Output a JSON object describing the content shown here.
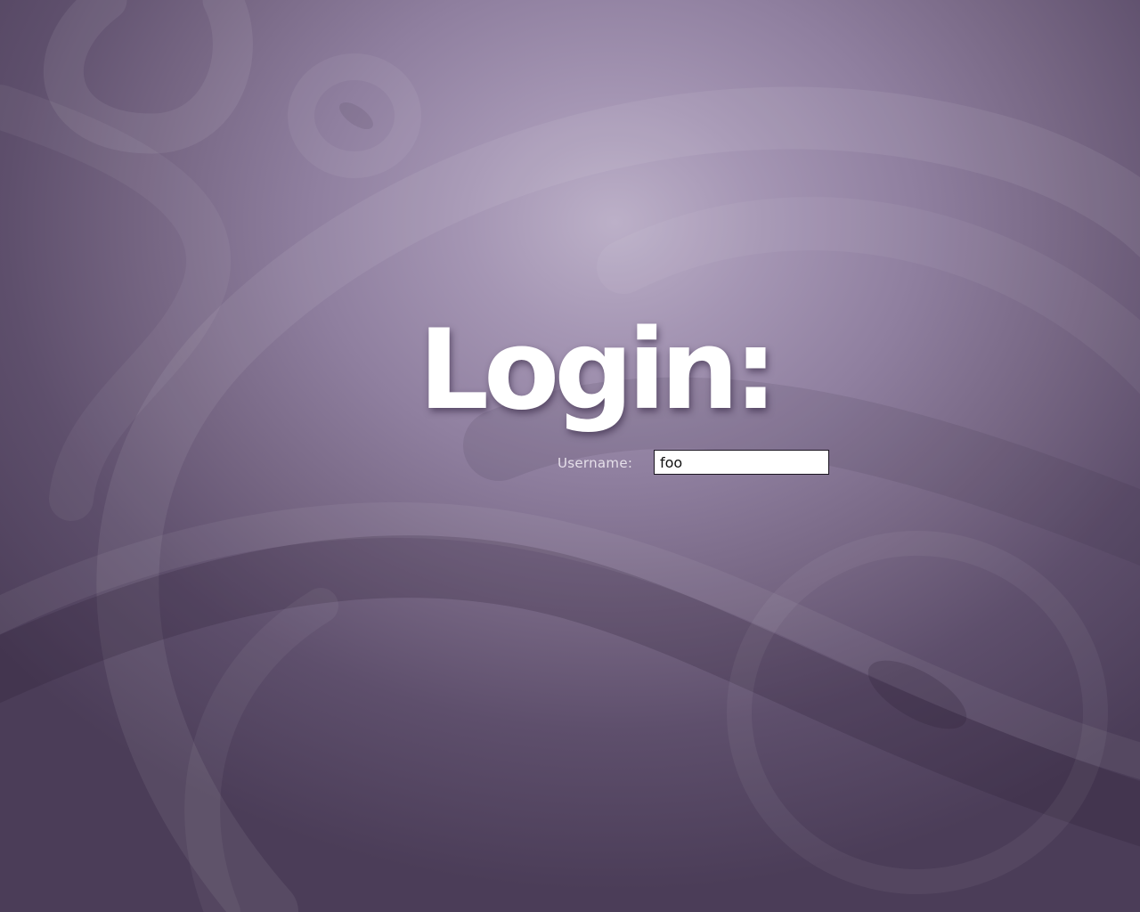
{
  "login": {
    "title": "Login:",
    "username_label": "Username:",
    "username_value": "foo"
  },
  "colors": {
    "background_light": "#bcb0c8",
    "background_dark": "#4b3d58",
    "title_text": "#ffffff",
    "input_background": "#ffffff",
    "input_border": "#1a1420"
  }
}
